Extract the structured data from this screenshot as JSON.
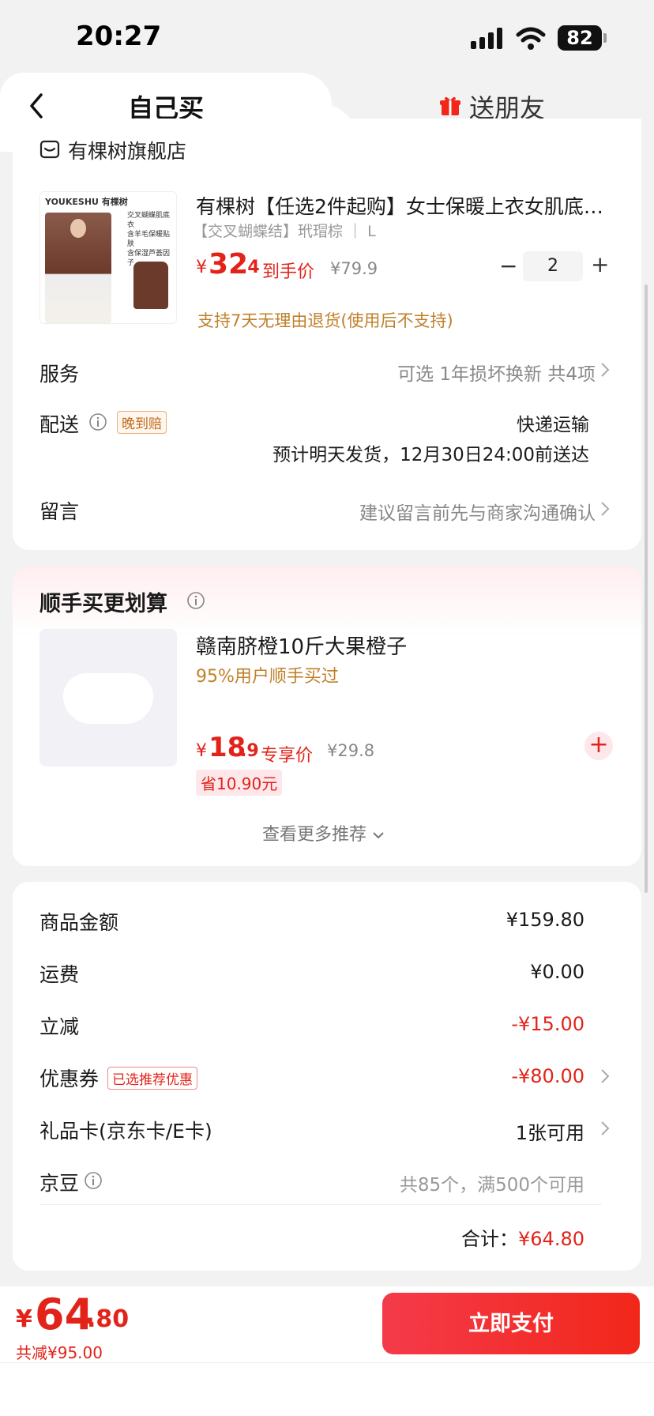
{
  "status_bar": {
    "time": "20:27",
    "battery": "82"
  },
  "tabs": {
    "self": "自己买",
    "friend": "送朋友"
  },
  "store": {
    "name": "有棵树旗舰店"
  },
  "product": {
    "image_brand": "YOUKESHU 有棵树",
    "image_text": [
      "交叉蝴蝶肌底衣",
      "含羊毛保暖贴肤",
      "含保湿芦荟因子"
    ],
    "title": "有棵树【任选2件起购】女士保暖上衣女肌底…",
    "spec": "【交叉蝴蝶结】玳瑁棕 ｜ L",
    "price_symbol": "¥",
    "price_int": "32",
    "price_dec": ".4",
    "price_label": "到手价",
    "original_price": "¥79.9",
    "quantity": "2",
    "minus": "−",
    "plus": "+",
    "return_note": "支持7天无理由退货(使用后不支持)"
  },
  "service": {
    "label": "服务",
    "value": "可选 1年损坏换新 共4项"
  },
  "shipping": {
    "label": "配送",
    "badge": "晚到赔",
    "method": "快递运输",
    "eta": "预计明天发货，12月30日24:00前送达"
  },
  "message": {
    "label": "留言",
    "placeholder": "建议留言前先与商家沟通确认"
  },
  "upsell": {
    "title": "顺手买更划算",
    "item_title": "赣南脐橙10斤大果橙子",
    "item_sub": "95%用户顺手买过",
    "price_symbol": "¥",
    "price_int": "18",
    "price_dec": ".9",
    "price_label": "专享价",
    "original_price": "¥29.8",
    "save": "省10.90元",
    "add": "+",
    "more": "查看更多推荐"
  },
  "summary": {
    "rows": [
      {
        "label": "商品金额",
        "value": "¥159.80"
      },
      {
        "label": "运费",
        "value": "¥0.00"
      },
      {
        "label": "立减",
        "value": "-¥15.00"
      },
      {
        "label": "优惠券",
        "badge": "已选推荐优惠",
        "value": "-¥80.00"
      },
      {
        "label": "礼品卡(京东卡/E卡)",
        "value": "1张可用"
      },
      {
        "label": "京豆",
        "value": "共85个，满500个可用"
      }
    ],
    "total_label": "合计：",
    "total_value": "¥64.80"
  },
  "bottom": {
    "price_symbol": "¥",
    "price_int": "64",
    "price_dec": ".80",
    "saved": "共减¥95.00",
    "pay_label": "立即支付"
  },
  "colors": {
    "accent": "#e2231a",
    "note": "#c0802a"
  }
}
